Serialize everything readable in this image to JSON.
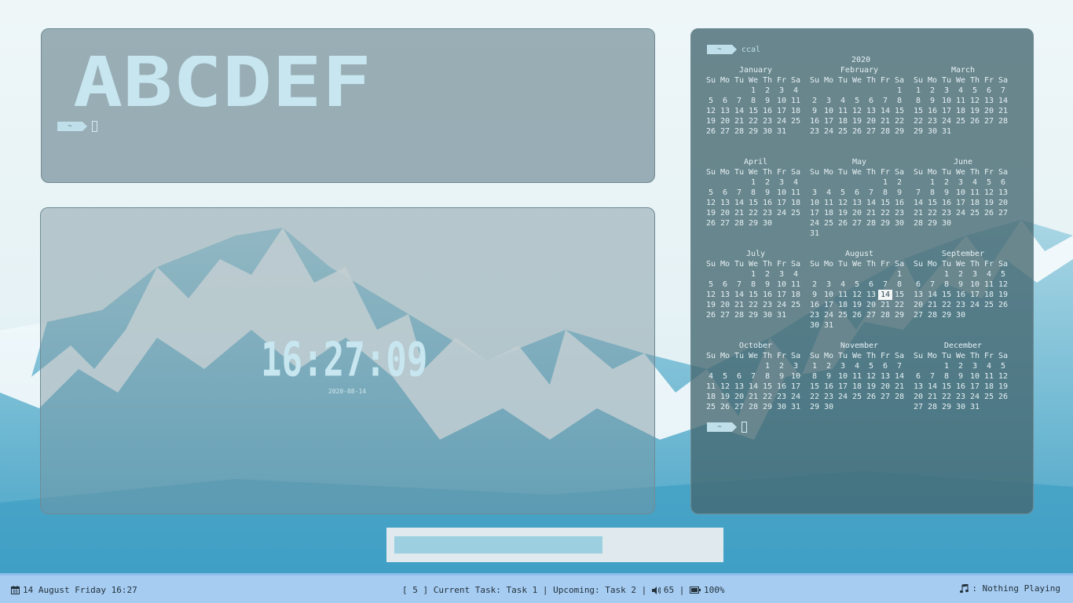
{
  "colors": {
    "accent": "#bfe0ea",
    "bar": "#a6ccf2",
    "panel_dark": "#446770",
    "highlight": "#f2f6f7"
  },
  "term1": {
    "banner": "ABCDEF",
    "prompt_dir": "~"
  },
  "term2": {
    "time": "16:27:09",
    "date": "2020-08-14"
  },
  "term3": {
    "prompt_dir": "~",
    "command": "ccal",
    "year": "2020",
    "weekdays": [
      "Su",
      "Mo",
      "Tu",
      "We",
      "Th",
      "Fr",
      "Sa"
    ],
    "months": [
      {
        "name": "January",
        "start": 3,
        "days": 31
      },
      {
        "name": "February",
        "start": 6,
        "days": 29
      },
      {
        "name": "March",
        "start": 0,
        "days": 31
      },
      {
        "name": "April",
        "start": 3,
        "days": 30
      },
      {
        "name": "May",
        "start": 5,
        "days": 31
      },
      {
        "name": "June",
        "start": 1,
        "days": 30
      },
      {
        "name": "July",
        "start": 3,
        "days": 31
      },
      {
        "name": "August",
        "start": 6,
        "days": 31,
        "highlight": 14
      },
      {
        "name": "September",
        "start": 2,
        "days": 30
      },
      {
        "name": "October",
        "start": 4,
        "days": 31
      },
      {
        "name": "November",
        "start": 0,
        "days": 30
      },
      {
        "name": "December",
        "start": 2,
        "days": 31
      }
    ],
    "prompt2_dir": "~"
  },
  "statusbar": {
    "left": {
      "icon": "calendar-icon",
      "text": "14 August Friday 16:27"
    },
    "mid": {
      "workspace": "[ 5 ]",
      "task": "Current Task: Task 1",
      "upcoming": "Upcoming: Task 2",
      "volume_icon": "volume-icon",
      "volume": "65",
      "battery_icon": "battery-icon",
      "battery": "100%",
      "sep": "|"
    },
    "right": {
      "icon": "music-note-icon",
      "text": ": Nothing Playing"
    }
  }
}
